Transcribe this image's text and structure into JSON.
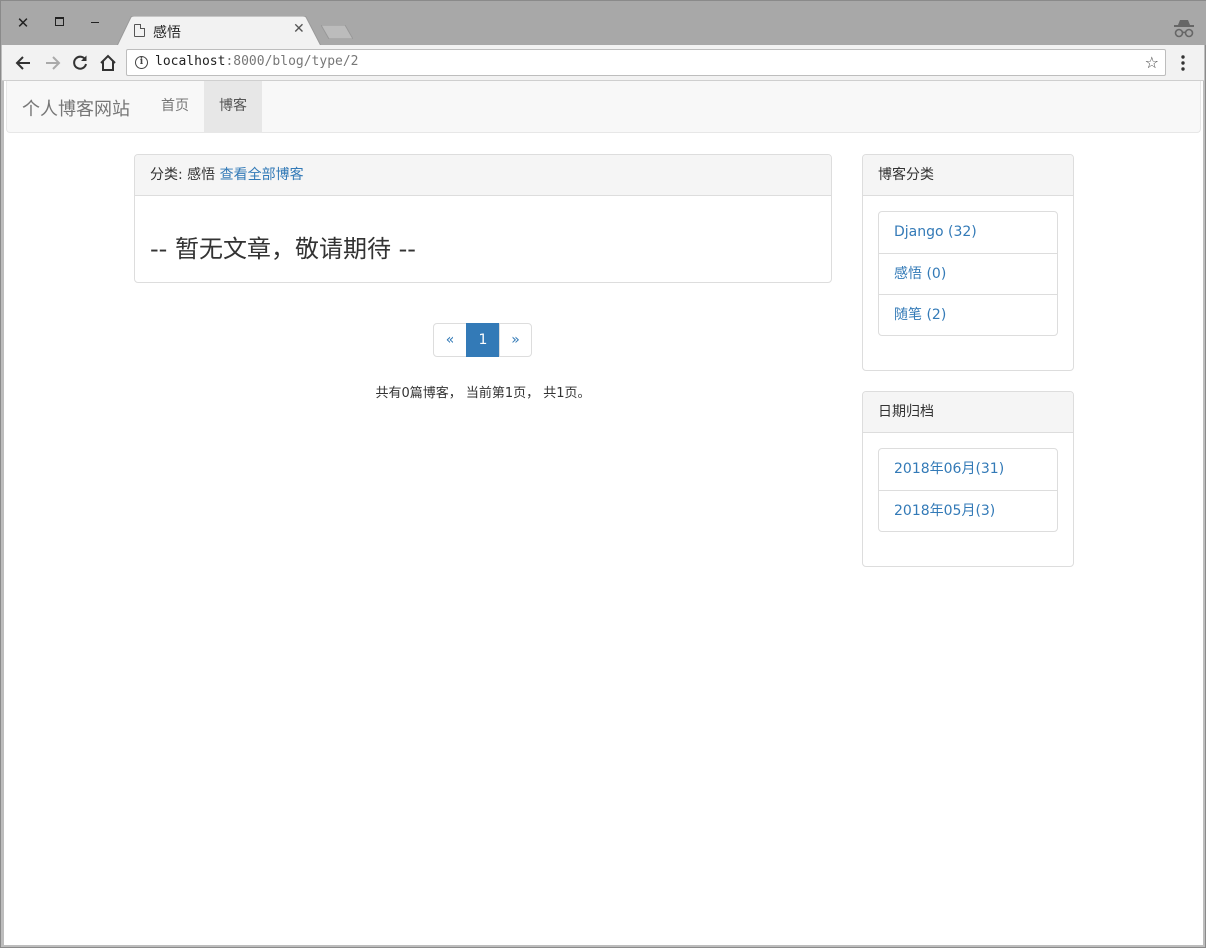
{
  "browser": {
    "tab_title": "感悟",
    "url_host": "localhost",
    "url_rest": ":8000/blog/type/2"
  },
  "navbar": {
    "brand": "个人博客网站",
    "links": [
      {
        "label": "首页",
        "active": false
      },
      {
        "label": "博客",
        "active": true
      }
    ]
  },
  "main": {
    "heading_prefix": "分类: 感悟",
    "heading_link": "查看全部博客",
    "empty_message": "-- 暂无文章，敬请期待 --",
    "pagination": {
      "prev": "«",
      "current": "1",
      "next": "»"
    },
    "page_info": "共有0篇博客， 当前第1页， 共1页。"
  },
  "sidebar": {
    "categories": {
      "title": "博客分类",
      "items": [
        "Django (32)",
        "感悟 (0)",
        "随笔 (2)"
      ]
    },
    "archives": {
      "title": "日期归档",
      "items": [
        "2018年06月(31)",
        "2018年05月(3)"
      ]
    }
  },
  "colors": {
    "link": "#337ab7",
    "navbar_bg": "#f8f8f8",
    "panel_heading_bg": "#f5f5f5"
  }
}
